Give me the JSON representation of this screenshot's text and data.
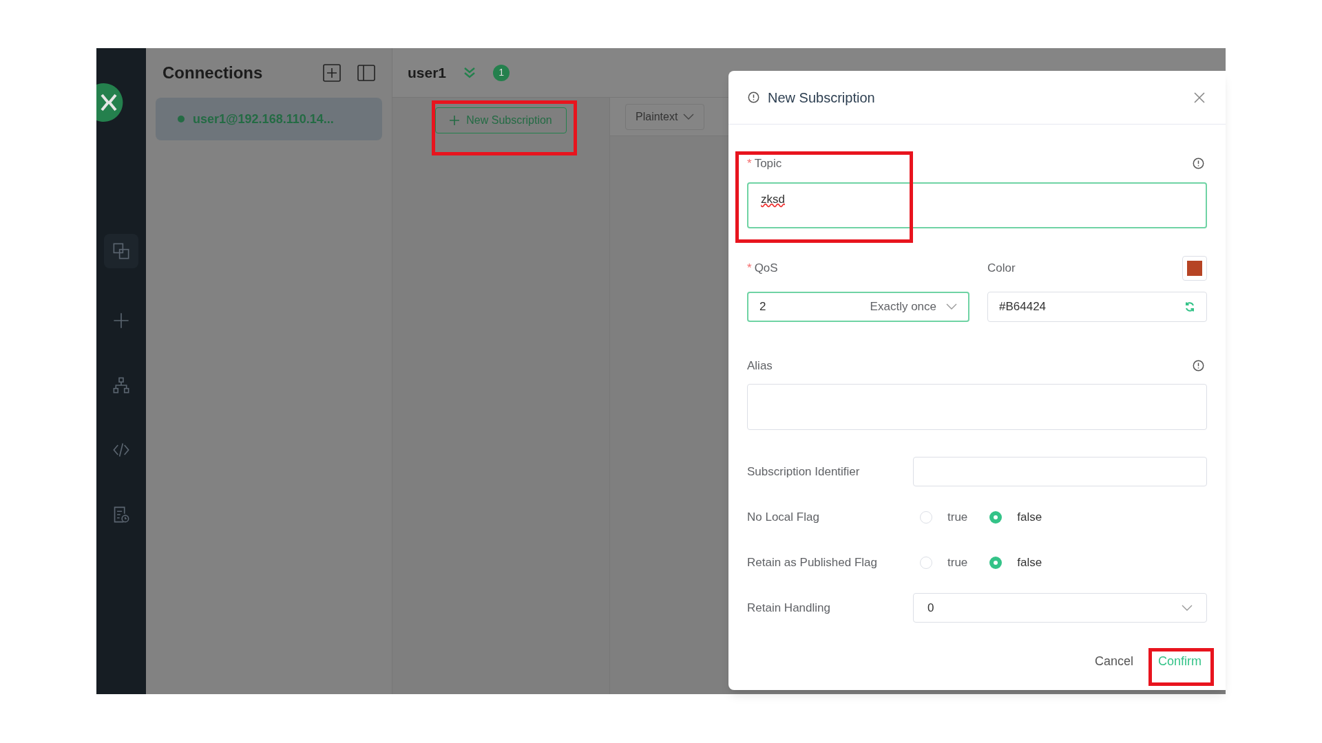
{
  "sidebar": {
    "items": [
      {
        "kind": "connections",
        "selected": true
      },
      {
        "kind": "new",
        "selected": false
      },
      {
        "kind": "topology",
        "selected": false
      },
      {
        "kind": "script",
        "selected": false
      },
      {
        "kind": "log",
        "selected": false
      }
    ]
  },
  "connections_panel": {
    "title": "Connections",
    "items": [
      {
        "label": "user1@192.168.110.14...",
        "selected": true
      }
    ]
  },
  "connection_header": {
    "title": "user1",
    "badge": "1"
  },
  "toolbar": {
    "new_subscription": "New Subscription",
    "format_select": "Plaintext"
  },
  "dialog": {
    "title": "New Subscription",
    "topic": {
      "label": "Topic",
      "required_mark": "*",
      "value": "zksd"
    },
    "qos": {
      "label": "QoS",
      "required_mark": "*",
      "value": "2",
      "description": "Exactly once"
    },
    "color": {
      "label": "Color",
      "value": "#B64424",
      "color": "#b64424"
    },
    "alias": {
      "label": "Alias"
    },
    "rows": [
      {
        "kind": "input",
        "label": "Subscription Identifier"
      },
      {
        "kind": "radio",
        "label": "No Local Flag",
        "options": [
          {
            "label": "true",
            "selected": false
          },
          {
            "label": "false",
            "selected": true
          }
        ]
      },
      {
        "kind": "radio",
        "label": "Retain as Published Flag",
        "options": [
          {
            "label": "true",
            "selected": false
          },
          {
            "label": "false",
            "selected": true
          }
        ]
      },
      {
        "kind": "select",
        "label": "Retain Handling",
        "value": "0"
      }
    ],
    "buttons": {
      "cancel": "Cancel",
      "confirm": "Confirm"
    }
  }
}
